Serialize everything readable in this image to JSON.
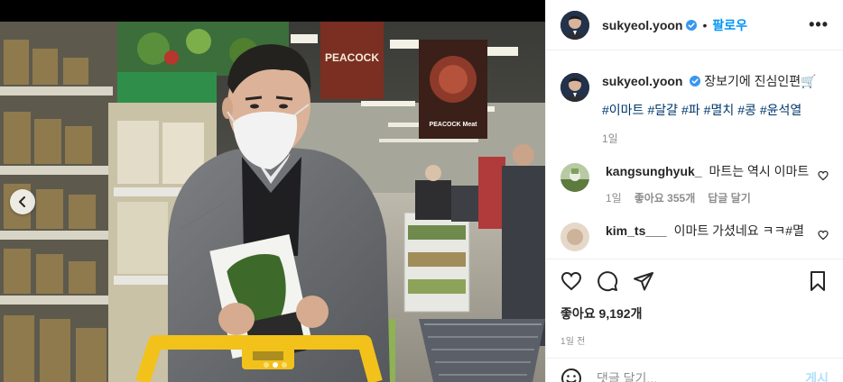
{
  "post": {
    "username": "sukyeol.yoon",
    "follow_label": "팔로우",
    "more_label": "•••",
    "separator": "•"
  },
  "caption": {
    "username": "sukyeol.yoon",
    "text": "장보기에 진심인편🛒",
    "hashtags": [
      "#이마트",
      "#달걀",
      "#파",
      "#멸치",
      "#콩",
      "#윤석열"
    ],
    "time": "1일"
  },
  "comments": [
    {
      "username": "kangsunghyuk_",
      "text": "마트는 역시 이마트",
      "time": "1일",
      "likes": "좋아요 355개",
      "reply_label": "답글 달기"
    },
    {
      "username": "kim_ts___",
      "text": "이마트 가셨네요 ㅋㅋ#멸",
      "time": "",
      "likes": "",
      "reply_label": ""
    }
  ],
  "engagement": {
    "likes": "좋아요 9,192개",
    "posted": "1일 전"
  },
  "comment_box": {
    "placeholder": "댓글 달기...",
    "post_label": "게시"
  },
  "photo": {
    "store_sign": "PEACOCK",
    "poster_text": "PEACOCK Meat",
    "slide_index": 2,
    "slide_count": 3
  },
  "colors": {
    "accent": "#0095f6",
    "hashtag": "#00376b",
    "muted": "#8e8e8e",
    "cart_yellow": "#f2c21b"
  }
}
